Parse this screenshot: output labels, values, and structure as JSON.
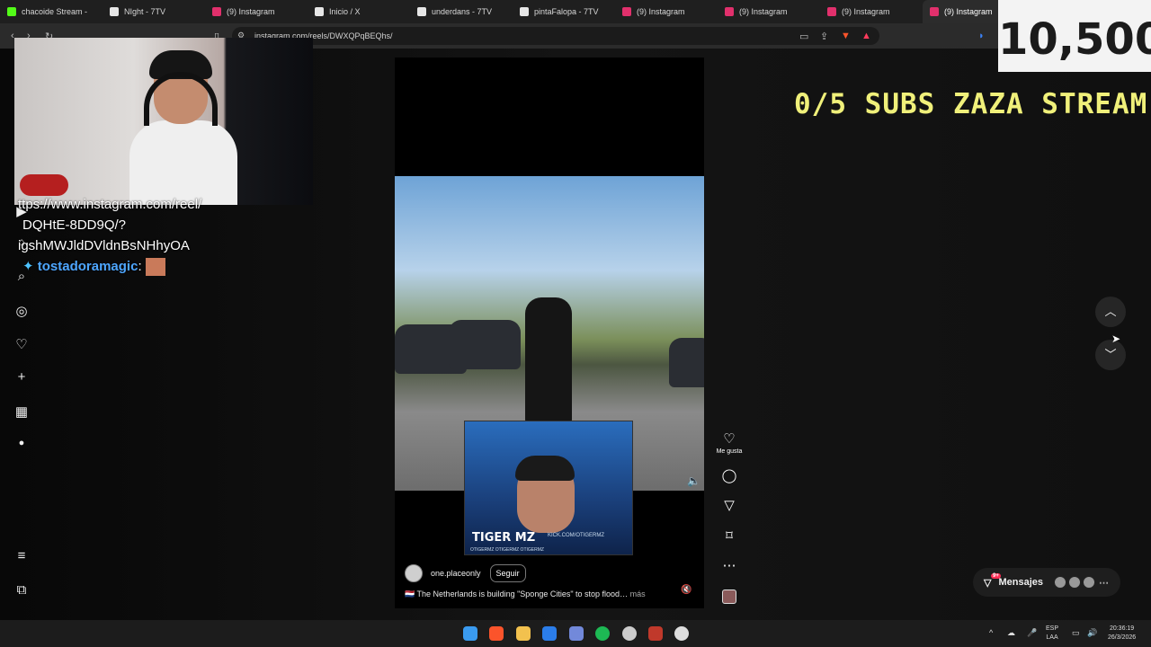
{
  "browser": {
    "tabs": [
      {
        "title": "chacoide Stream -",
        "icon_color": "#53fc18"
      },
      {
        "title": "NIght - 7TV",
        "icon_color": "#e6e6e6"
      },
      {
        "title": "(9) Instagram",
        "icon_color": "#e1306c"
      },
      {
        "title": "Inicio / X",
        "icon_color": "#e6e6e6"
      },
      {
        "title": "underdans - 7TV",
        "icon_color": "#e6e6e6"
      },
      {
        "title": "pintaFalopa - 7TV",
        "icon_color": "#e6e6e6"
      },
      {
        "title": "(9) Instagram",
        "icon_color": "#e1306c"
      },
      {
        "title": "(9) Instagram",
        "icon_color": "#e1306c"
      },
      {
        "title": "(9) Instagram",
        "icon_color": "#e1306c"
      },
      {
        "title": "(9) Instagram",
        "icon_color": "#e1306c",
        "active": true
      }
    ],
    "url": "instagram.com/reels/DWXQPqBEQhs/"
  },
  "stream_overlay": {
    "counter": "10,500",
    "goal": "0/5 SUBS ZAZA STREAM",
    "chat": {
      "line1": "ttps://www.instagram.com/reel/",
      "line2": "DQHtE-8DD9Q/?",
      "line3": "igshMWJldDVldnBsNHhyOA",
      "user": "tostadoramagic",
      "sep": ":"
    },
    "cam2": {
      "name": "TIGER MZ",
      "kick": "KICK.COM/OTIGERMZ",
      "socials": "OTIGERMZ   OTIGERMZ   OTIGERMZ"
    }
  },
  "reel": {
    "author": "one.placeonly",
    "follow_label": "Seguir",
    "caption": "🇳🇱 The Netherlands is building \"Sponge Cities\" to stop flood…",
    "more_label": "más",
    "like_label": "Me gusta"
  },
  "sidebar_icons": [
    "reels-icon",
    "notifications-icon",
    "search-icon",
    "explore-icon",
    "activity-icon",
    "create-icon",
    "dashboard-icon",
    "profile-icon",
    "menu-icon",
    "also-from-meta-icon"
  ],
  "messages": {
    "label": "Mensajes",
    "badge": "9+"
  },
  "taskbar": {
    "lang": "ESP",
    "region": "LAA",
    "time": "20:36:19",
    "date": "26/3/2026"
  }
}
